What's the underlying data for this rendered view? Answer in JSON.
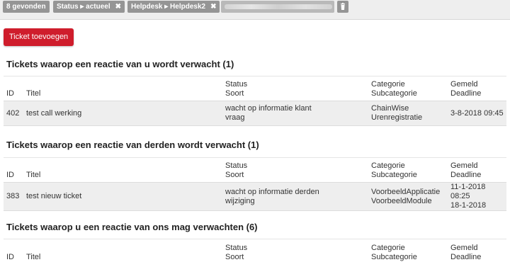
{
  "filters": {
    "found_label": "8 gevonden",
    "status_chip": "Status ▸ actueel",
    "helpdesk_chip": "Helpdesk ▸ Helpdesk2",
    "remove_glyph": "✖"
  },
  "add_button_label": "Ticket toevoegen",
  "columns": {
    "id": "ID",
    "title": "Titel",
    "status": "Status",
    "kind": "Soort",
    "category": "Categorie",
    "subcategory": "Subcategorie",
    "reported": "Gemeld",
    "deadline": "Deadline"
  },
  "sections": [
    {
      "title": "Tickets waarop een reactie van u wordt verwacht (1)",
      "rows": [
        {
          "id": "402",
          "title": "test call werking",
          "status": "wacht op informatie klant",
          "kind": "vraag",
          "category": "ChainWise",
          "subcategory": "Urenregistratie",
          "reported": "3-8-2018 09:45",
          "deadline": ""
        }
      ]
    },
    {
      "title": "Tickets waarop een reactie van derden wordt verwacht (1)",
      "rows": [
        {
          "id": "383",
          "title": "test nieuw ticket",
          "status": "wacht op informatie derden",
          "kind": "wijziging",
          "category": "VoorbeeldApplicatie",
          "subcategory": "VoorbeeldModule",
          "reported": "11-1-2018 08:25",
          "deadline": "18-1-2018"
        }
      ]
    },
    {
      "title": "Tickets waarop u een reactie van ons mag verwachten (6)",
      "rows": []
    }
  ],
  "icons": {
    "trash": "trash-icon",
    "remove": "close-icon"
  },
  "colors": {
    "accent_button": "#cf1d2c",
    "chip": "#959595",
    "row_bg": "#eeeeee"
  }
}
